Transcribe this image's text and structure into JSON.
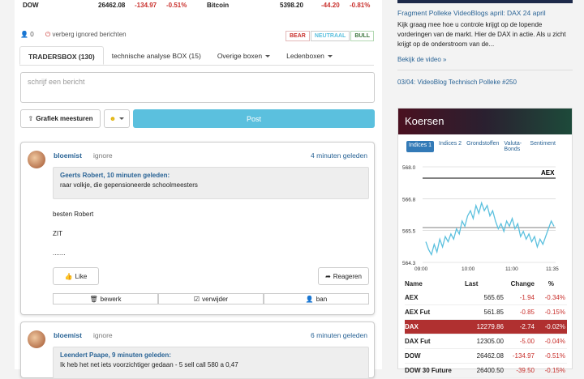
{
  "top": {
    "c1": "DOW",
    "c2": "26462.08",
    "c3": "-134.97",
    "c4": "-0.51%",
    "c5": "Bitcoin",
    "c6": "5398.20",
    "c7": "-44.20",
    "c8": "-0.81%"
  },
  "controls": {
    "count": "0",
    "ignored": "verberg ignored berichten",
    "bear": "BEAR",
    "neutral": "NEUTRAAL",
    "bull": "BULL"
  },
  "tabs": [
    "TRADERSBOX (130)",
    "technische analyse BOX (15)",
    "Overige boxen",
    "Ledenboxen"
  ],
  "message": {
    "placeholder": "schrijf een bericht",
    "chart_btn": "Grafiek meesturen",
    "post": "Post"
  },
  "posts": [
    {
      "user": "bloemist",
      "ignore": "ignore",
      "time": "4 minuten geleden",
      "quote_head": "Geerts Robert, 10 minuten geleden:",
      "quote_text": "raar volkje, die gepensioneerde schoolmeesters",
      "lines": [
        "besten Robert",
        "ZIT",
        "......."
      ],
      "like": "Like",
      "reply": "Reageren",
      "edit": "bewerk",
      "delete": "verwijder",
      "ban": "ban"
    },
    {
      "user": "bloemist",
      "ignore": "ignore",
      "time": "6 minuten geleden",
      "quote_head": "Leendert Paape, 9 minuten geleden:",
      "quote_text": "Ik heb het net iets voorzichtiger gedaan - 5 sell call 580 a 0,47"
    }
  ],
  "news": {
    "title": "Fragment Polleke VideoBlogs april: DAX 24 april",
    "text": "Kijk graag mee hoe u controle krijgt op de lopende vorderingen van de markt. Hier de DAX in actie. Als u zicht krijgt op de onderstroom van de...",
    "link": "Bekijk de video »",
    "link2": "03/04: VideoBlog Technisch Polleke #250"
  },
  "koersen": {
    "title": "Koersen",
    "tabs": [
      "Indices 1",
      "Indices 2",
      "Grondstoffen",
      "Valuta-Bonds",
      "Sentiment"
    ],
    "headers": [
      "Name",
      "Last",
      "Change",
      "%"
    ],
    "rows": [
      [
        "AEX",
        "565.65",
        "-1.94",
        "-0.34%"
      ],
      [
        "AEX Fut",
        "561.85",
        "-0.85",
        "-0.15%"
      ],
      [
        "DAX",
        "12279.86",
        "-2.74",
        "-0.02%"
      ],
      [
        "DAX Fut",
        "12305.00",
        "-5.00",
        "-0.04%"
      ],
      [
        "DOW",
        "26462.08",
        "-134.97",
        "-0.51%"
      ],
      [
        "DOW 30 Future",
        "26400.50",
        "-39.50",
        "-0.15%"
      ]
    ]
  },
  "chart_data": {
    "type": "line",
    "title": "AEX",
    "x_ticks": [
      "09:00",
      "10:00",
      "11:00",
      "11:35"
    ],
    "y_ticks": [
      "568.0",
      "566.8",
      "565.5",
      "564.3"
    ],
    "ylim": [
      564.3,
      568.0
    ],
    "color": "#5bc0de",
    "values": [
      565.1,
      564.8,
      564.6,
      565.0,
      564.7,
      565.2,
      564.9,
      565.3,
      565.1,
      565.4,
      565.2,
      565.6,
      565.4,
      565.9,
      565.7,
      566.1,
      566.3,
      566.0,
      566.5,
      566.2,
      566.6,
      566.3,
      566.5,
      566.1,
      566.3,
      565.9,
      565.6,
      565.8,
      565.5,
      565.9,
      565.7,
      566.0,
      565.6,
      565.8,
      565.3,
      565.5,
      565.2,
      565.4,
      565.1,
      565.3,
      564.9,
      565.2,
      565.0,
      565.3,
      565.6,
      565.9,
      565.7
    ]
  }
}
